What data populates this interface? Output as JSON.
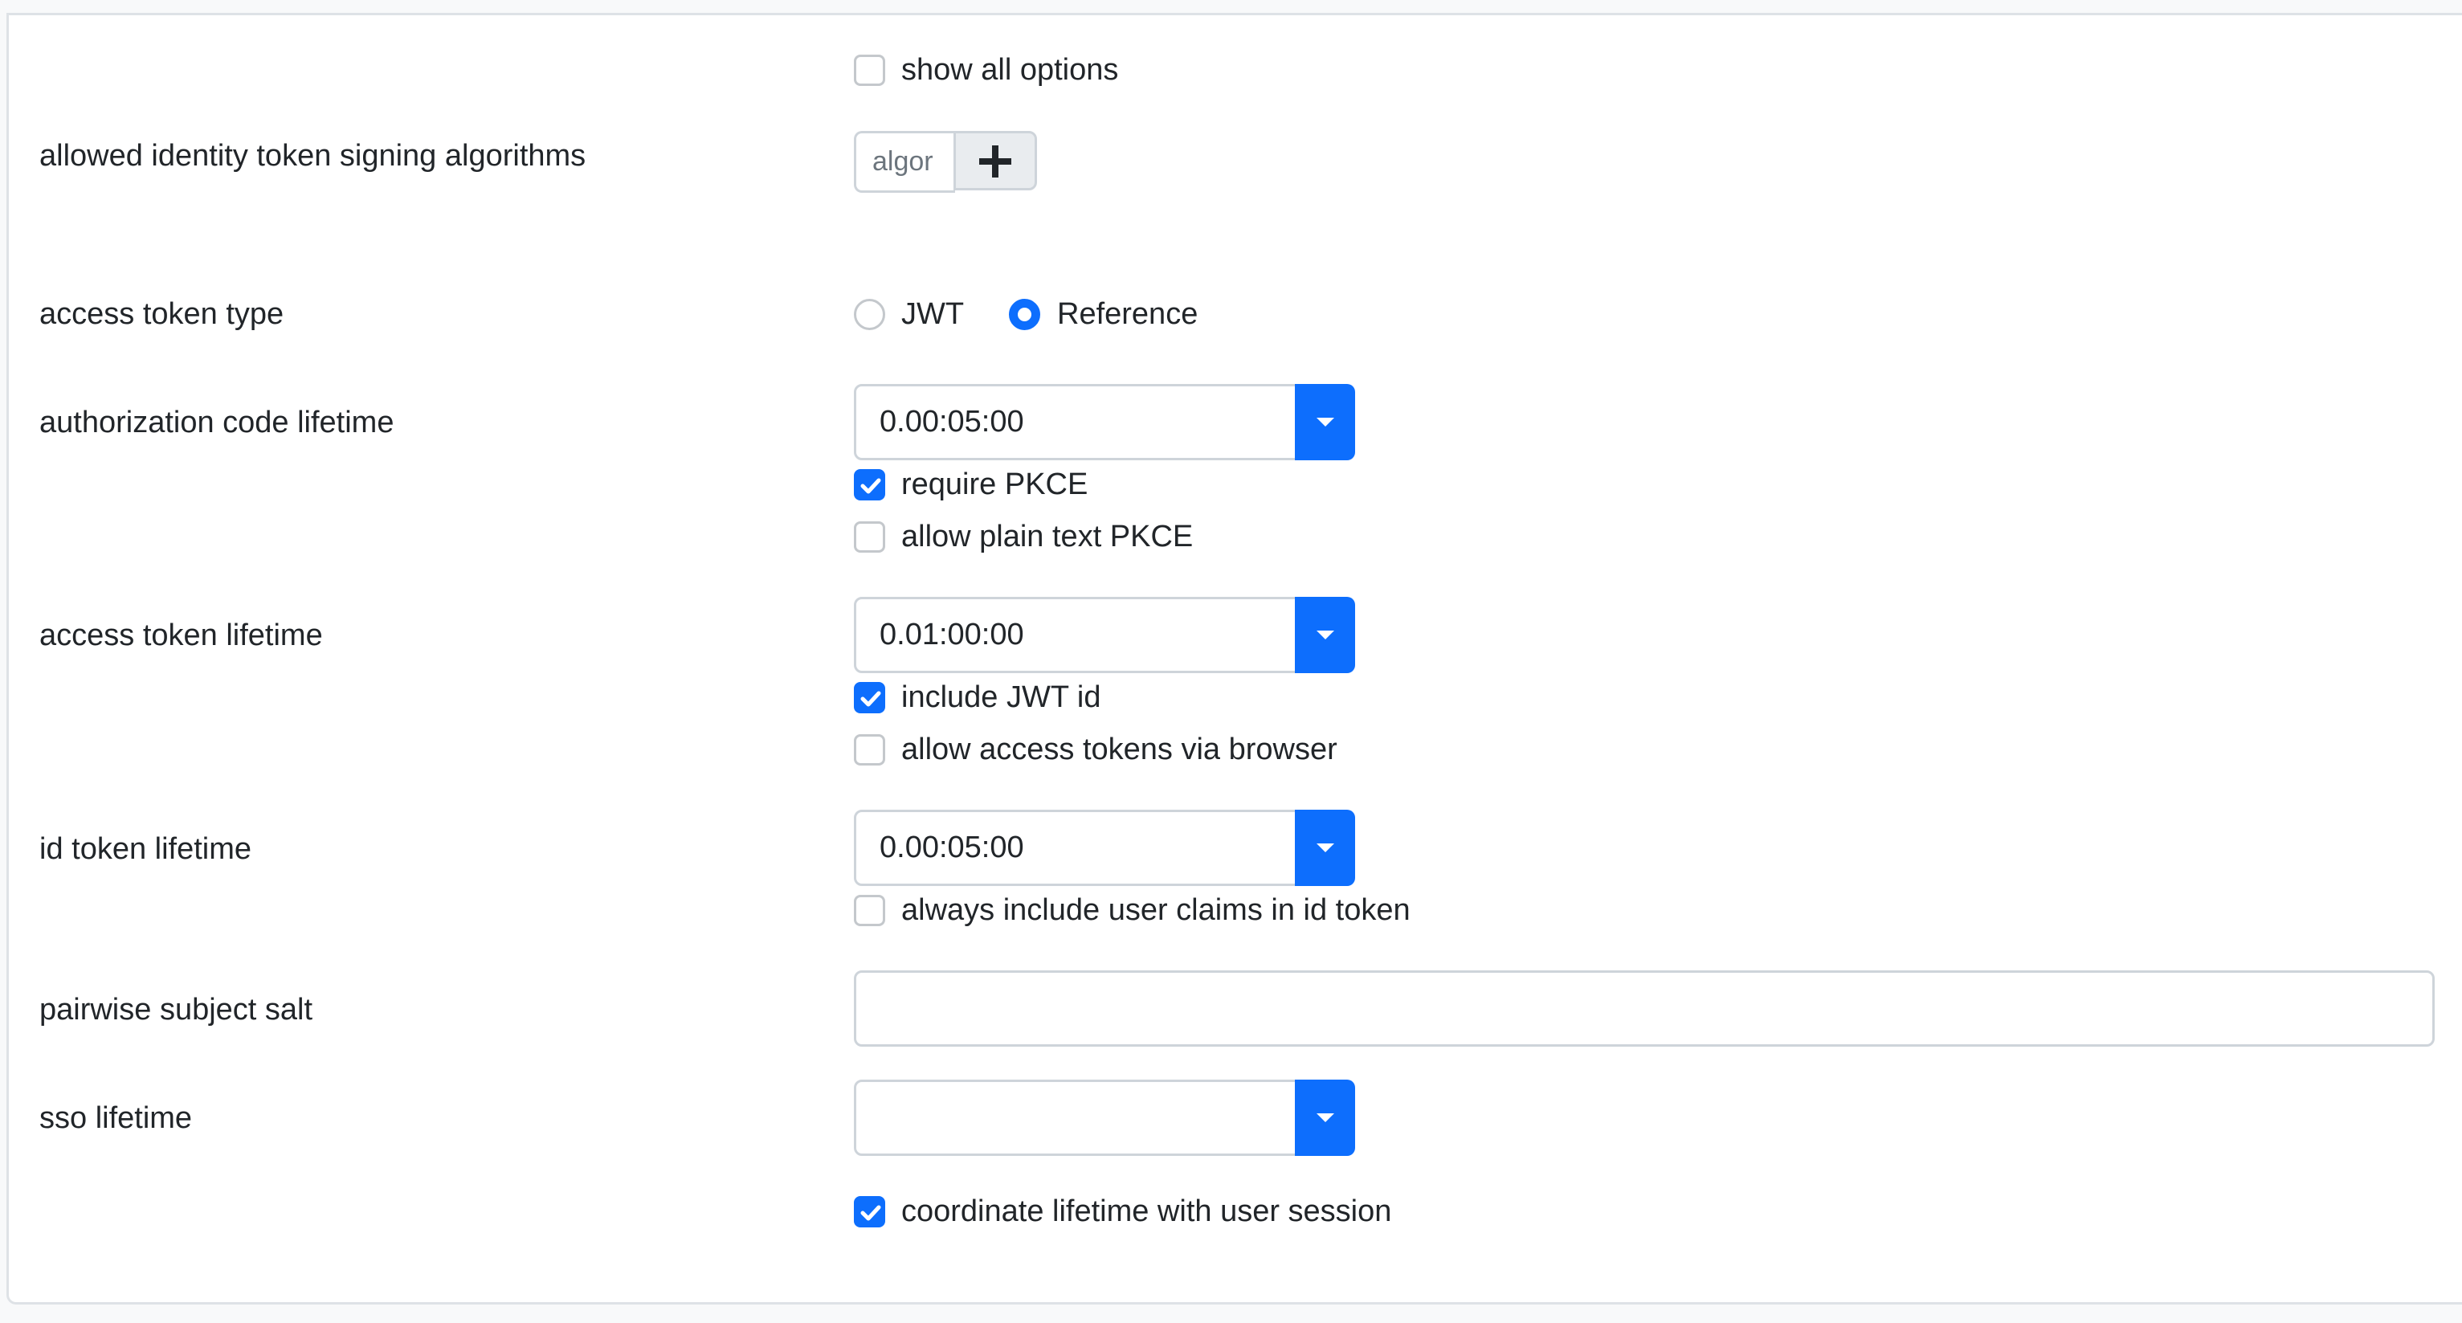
{
  "form": {
    "show_all_options": {
      "label": "show all options",
      "checked": false
    },
    "signing_algorithms": {
      "label": "allowed identity token signing algorithms",
      "input_placeholder": "algor",
      "add_icon": "plus-icon"
    },
    "access_token_type": {
      "label": "access token type",
      "options": [
        {
          "label": "JWT",
          "selected": false
        },
        {
          "label": "Reference",
          "selected": true
        }
      ]
    },
    "authorization_code_lifetime": {
      "label": "authorization code lifetime",
      "value": "0.00:05:00",
      "dropdown_icon": "caret-down-icon",
      "checkboxes": [
        {
          "label": "require PKCE",
          "checked": true
        },
        {
          "label": "allow plain text PKCE",
          "checked": false
        }
      ]
    },
    "access_token_lifetime": {
      "label": "access token lifetime",
      "value": "0.01:00:00",
      "dropdown_icon": "caret-down-icon",
      "checkboxes": [
        {
          "label": "include JWT id",
          "checked": true
        },
        {
          "label": "allow access tokens via browser",
          "checked": false
        }
      ]
    },
    "id_token_lifetime": {
      "label": "id token lifetime",
      "value": "0.00:05:00",
      "dropdown_icon": "caret-down-icon",
      "checkboxes": [
        {
          "label": "always include user claims in id token",
          "checked": false
        }
      ]
    },
    "pairwise_subject_salt": {
      "label": "pairwise subject salt",
      "value": ""
    },
    "sso_lifetime": {
      "label": "sso lifetime",
      "value": "",
      "dropdown_icon": "caret-down-icon",
      "checkboxes": [
        {
          "label": "coordinate lifetime with user session",
          "checked": true
        }
      ]
    }
  },
  "colors": {
    "accent": "#0d6efd",
    "text": "#212529",
    "border": "#ced4da",
    "placeholder": "#6c757d",
    "page_bg": "#f8f9fa"
  }
}
